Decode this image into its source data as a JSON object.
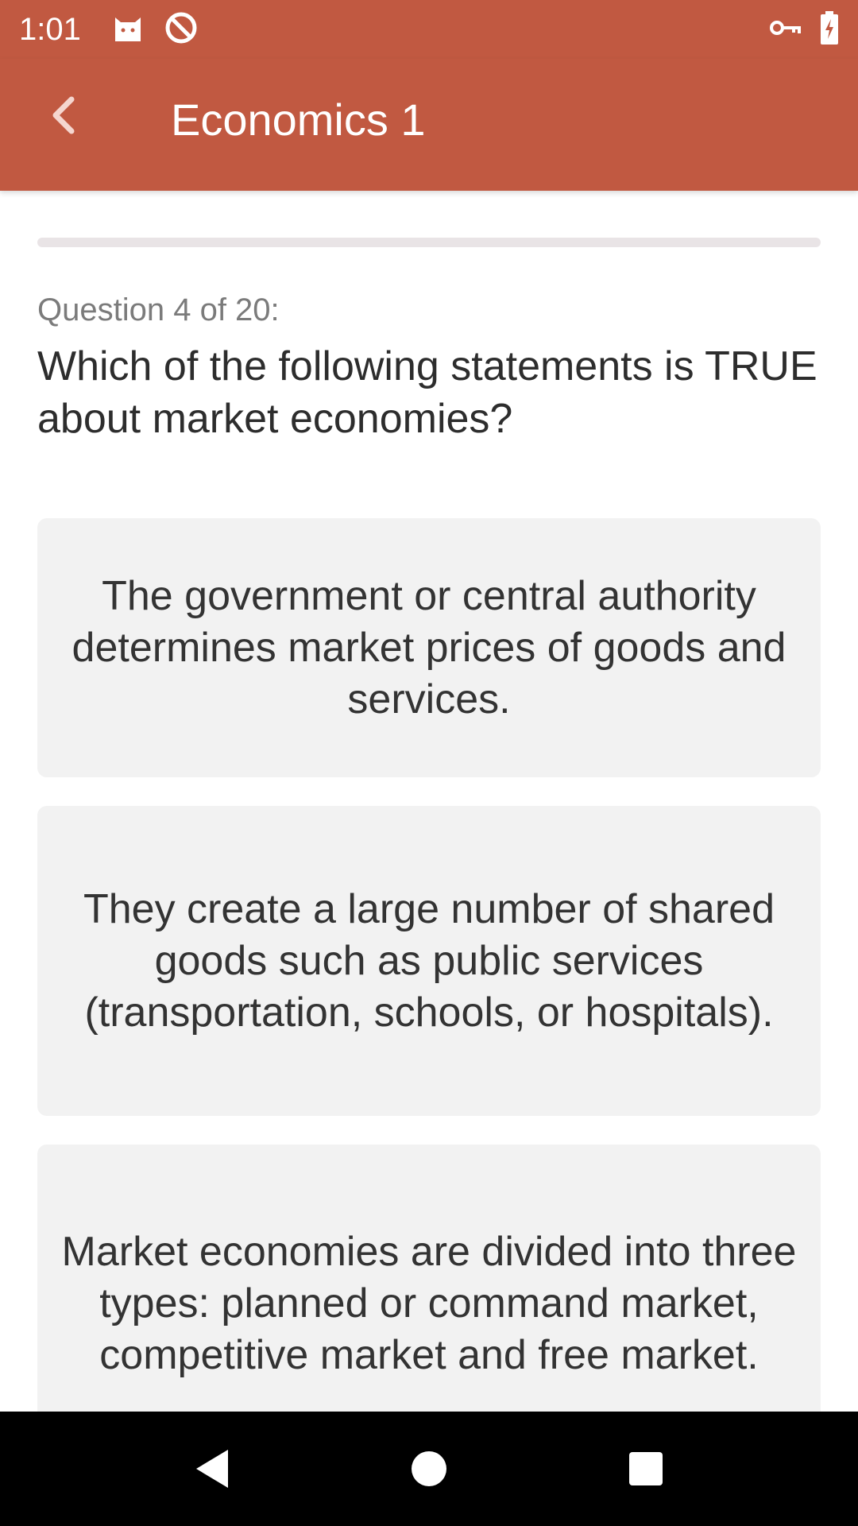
{
  "status_bar": {
    "time": "1:01",
    "icons": [
      "cat-notification-icon",
      "blocked-circle-icon",
      "vpn-key-icon",
      "battery-charging-icon"
    ]
  },
  "app_bar": {
    "title": "Economics 1",
    "back_icon": "chevron-left-icon"
  },
  "quiz": {
    "progress": 0.0,
    "counter": "Question 4 of 20:",
    "question": "Which of the following statements is TRUE about market economies?",
    "answers": [
      "The government or central authority determines market prices of goods and services.",
      "They create a large number of shared goods such as public services (transportation, schools, or hospitals).",
      "Market economies are divided into three types: planned or command market, competitive market and free market."
    ]
  },
  "nav_bar": {
    "icons": [
      "back-triangle-icon",
      "home-circle-icon",
      "recents-square-icon"
    ]
  },
  "colors": {
    "primary": "#c15941",
    "card_bg": "#f2f2f2",
    "text": "#2d2d2d",
    "muted": "#7b7b7b"
  }
}
